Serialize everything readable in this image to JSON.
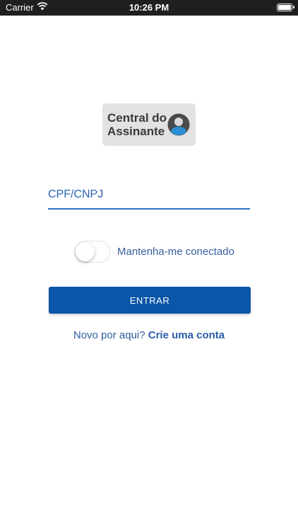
{
  "status_bar": {
    "carrier": "Carrier",
    "time": "10:26 PM",
    "icons": [
      "wifi-icon",
      "battery-icon"
    ]
  },
  "logo": {
    "line1": "Central do",
    "line2": "Assinante",
    "icon": "user-avatar-icon"
  },
  "login": {
    "cpf_placeholder": "CPF/CNPJ",
    "cpf_value": "",
    "remember_label": "Mantenha-me conectado",
    "remember_on": false,
    "enter_label": "ENTRAR"
  },
  "signup": {
    "prompt": "Novo por aqui?",
    "link": "Crie uma conta"
  },
  "colors": {
    "primary": "#0a56a8",
    "status_bar": "#1f1f1f",
    "text_blue": "#2f5e9e"
  }
}
